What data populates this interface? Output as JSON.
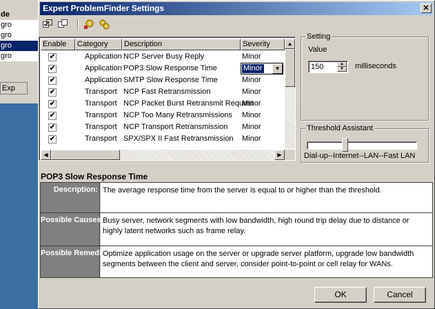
{
  "background_window": {
    "header": "de",
    "rows": [
      "gro",
      "gro",
      "gro",
      "gro"
    ],
    "button": "Exp"
  },
  "dialog": {
    "title": "Expert ProblemFinder Settings",
    "close_glyph": "✕"
  },
  "toolbar": {
    "icons": [
      "check-all-icon",
      "uncheck-all-icon",
      "gear-settings-icon",
      "gears-defaults-icon"
    ]
  },
  "list": {
    "columns": [
      "Enable",
      "Category",
      "Description",
      "Severity"
    ],
    "rows": [
      {
        "enabled": true,
        "category": "Application",
        "description": "NCP Server Busy Reply",
        "severity": "Minor"
      },
      {
        "enabled": true,
        "category": "Application",
        "description": "POP3 Slow Response Time",
        "severity": "Minor",
        "selected": true
      },
      {
        "enabled": true,
        "category": "Application",
        "description": "SMTP Slow Response Time",
        "severity": "Minor"
      },
      {
        "enabled": true,
        "category": "Transport",
        "description": "NCP Fast Retransmission",
        "severity": "Minor"
      },
      {
        "enabled": true,
        "category": "Transport",
        "description": "NCP Packet Burst Retransmit Request",
        "severity": "Minor"
      },
      {
        "enabled": true,
        "category": "Transport",
        "description": "NCP Too Many Retransmissions",
        "severity": "Minor"
      },
      {
        "enabled": true,
        "category": "Transport",
        "description": "NCP Transport Retransmission",
        "severity": "Minor"
      },
      {
        "enabled": true,
        "category": "Transport",
        "description": "SPX/SPX II Fast Retransmission",
        "severity": "Minor"
      }
    ]
  },
  "setting": {
    "group_label": "Setting",
    "value_label": "Value",
    "value": "150",
    "unit": "milliseconds"
  },
  "threshold": {
    "group_label": "Threshold Assistant",
    "scale_label": "Dial-up--Internet--LAN--Fast LAN",
    "level": 0.34
  },
  "detail": {
    "title": "POP3 Slow Response Time",
    "description_label": "Description:",
    "description": "The average response time from the server is equal to or higher than the threshold.",
    "causes_label": "Possible Causes:",
    "causes": "Busy server, network segments with low bandwidth, high round trip delay due to distance or highly latent networks such as frame relay.",
    "remedies_label": "Possible Remedies:",
    "remedies": "Optimize application usage on the server or upgrade server platform, upgrade low bandwidth segments between the client and server, consider point-to-point or cell relay for WANs."
  },
  "buttons": {
    "ok": "OK",
    "cancel": "Cancel"
  }
}
